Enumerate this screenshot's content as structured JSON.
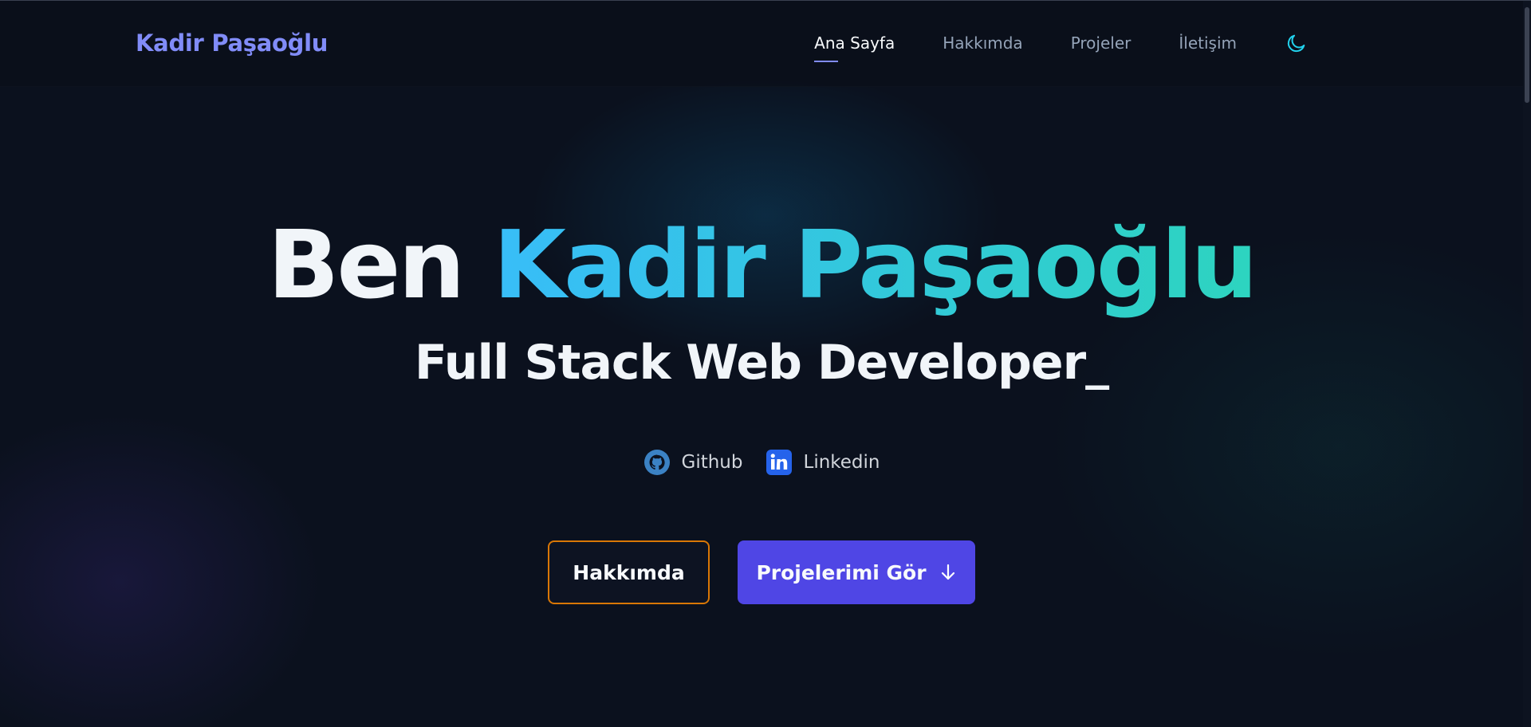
{
  "brand": {
    "name": "Kadir Paşaoğlu"
  },
  "nav": {
    "items": [
      {
        "label": "Ana Sayfa",
        "active": true
      },
      {
        "label": "Hakkımda",
        "active": false
      },
      {
        "label": "Projeler",
        "active": false
      },
      {
        "label": "İletişim",
        "active": false
      }
    ],
    "theme_icon": "moon-icon"
  },
  "hero": {
    "title_first": "Ben",
    "title_name": "Kadir Paşaoğlu",
    "subtitle": "Full Stack Web Developer_"
  },
  "socials": [
    {
      "label": "Github",
      "icon": "github-icon"
    },
    {
      "label": "Linkedin",
      "icon": "linkedin-icon"
    }
  ],
  "buttons": {
    "about_label": "Hakkımda",
    "projects_label": "Projelerimi Gör",
    "projects_icon": "arrow-down-icon"
  },
  "colors": {
    "background": "#0b111e",
    "brand": "#818cf8",
    "gradient_start": "#38bdf8",
    "gradient_end": "#2dd4bf",
    "primary_button": "#4f46e5",
    "outline_button_border": "#d97706"
  }
}
